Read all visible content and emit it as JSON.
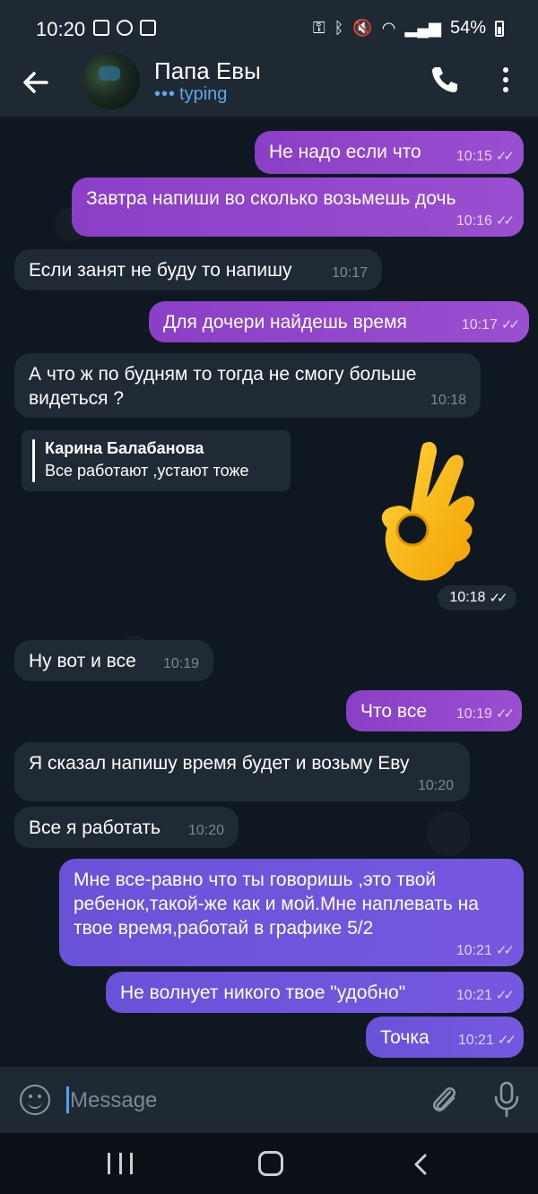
{
  "status_bar": {
    "time": "10:20",
    "battery": "54%"
  },
  "header": {
    "title": "Папа Евы",
    "status": "typing",
    "status_dots": "•••"
  },
  "messages": [
    {
      "dir": "out",
      "text": "Не надо если что",
      "time": "10:15"
    },
    {
      "dir": "out",
      "text": "Завтра напиши во сколько возьмешь дочь",
      "time": "10:16"
    },
    {
      "dir": "in",
      "text": "Если занят не буду то напишу",
      "time": "10:17"
    },
    {
      "dir": "out",
      "text": "Для дочери найдешь время",
      "time": "10:17"
    },
    {
      "dir": "in",
      "text": "А что ж по будням то тогда не смогу больше видеться ?",
      "time": "10:18"
    },
    {
      "dir": "out",
      "type": "sticker",
      "emoji": "👌",
      "time": "10:18",
      "reply": {
        "name": "Карина Балабанова",
        "text": "Все работают ,устают тоже"
      }
    },
    {
      "dir": "in",
      "text": "Ну вот и все",
      "time": "10:19"
    },
    {
      "dir": "out",
      "text": "Что все",
      "time": "10:19"
    },
    {
      "dir": "in",
      "text": "Я сказал напишу время будет и возьму Еву",
      "time": "10:20"
    },
    {
      "dir": "in",
      "text": "Все я работать",
      "time": "10:20"
    },
    {
      "dir": "out",
      "text": "Мне все-равно что ты говоришь ,это твой ребенок,такой-же как и мой.Мне наплевать на твое время,работай в графике 5/2",
      "time": "10:21"
    },
    {
      "dir": "out",
      "text": "Не волнует никого твое \"удобно\"",
      "time": "10:21"
    },
    {
      "dir": "out",
      "text": "Точка",
      "time": "10:21"
    }
  ],
  "input": {
    "placeholder": "Message"
  },
  "read_ticks": "✓✓"
}
